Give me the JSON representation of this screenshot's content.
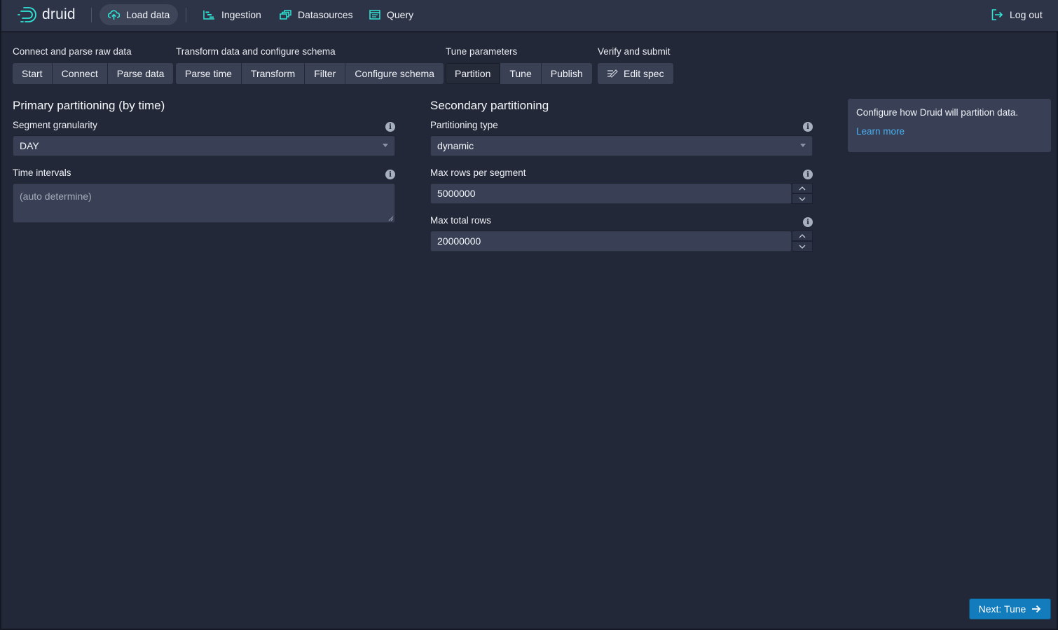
{
  "header": {
    "logo_text": "druid",
    "nav": [
      {
        "label": "Load data",
        "icon": "cloud-upload-icon",
        "active": true
      },
      {
        "label": "Ingestion",
        "icon": "gantt-chart-icon"
      },
      {
        "label": "Datasources",
        "icon": "multi-select-icon"
      },
      {
        "label": "Query",
        "icon": "application-icon"
      }
    ],
    "logout_label": "Log out"
  },
  "steps": {
    "groups": [
      {
        "title": "Connect and parse raw data",
        "items": [
          "Start",
          "Connect",
          "Parse data"
        ]
      },
      {
        "title": "Transform data and configure schema",
        "items": [
          "Parse time",
          "Transform",
          "Filter",
          "Configure schema"
        ]
      },
      {
        "title": "Tune parameters",
        "items": [
          "Partition",
          "Tune",
          "Publish"
        ],
        "active": "Partition"
      },
      {
        "title": "Verify and submit",
        "items": [
          "Edit spec"
        ]
      }
    ]
  },
  "primary": {
    "title": "Primary partitioning (by time)",
    "segment_granularity_label": "Segment granularity",
    "segment_granularity_value": "DAY",
    "time_intervals_label": "Time intervals",
    "time_intervals_placeholder": "(auto determine)"
  },
  "secondary": {
    "title": "Secondary partitioning",
    "partitioning_type_label": "Partitioning type",
    "partitioning_type_value": "dynamic",
    "max_rows_per_segment_label": "Max rows per segment",
    "max_rows_per_segment_value": "5000000",
    "max_total_rows_label": "Max total rows",
    "max_total_rows_value": "20000000"
  },
  "info_panel": {
    "text": "Configure how Druid will partition data.",
    "link": "Learn more"
  },
  "footer": {
    "next_label": "Next: Tune"
  },
  "colors": {
    "accent": "#137cbd",
    "link": "#48aff0",
    "icon_cyan": "#2ee6d6"
  }
}
